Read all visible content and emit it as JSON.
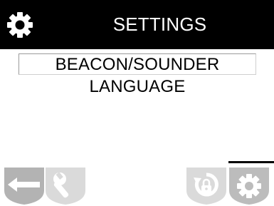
{
  "header": {
    "title": "SETTINGS",
    "icon": "gear-icon"
  },
  "menu": {
    "items": [
      {
        "label": "BEACON/SOUNDER",
        "selected": true
      },
      {
        "label": "LANGUAGE",
        "selected": false
      }
    ]
  },
  "footer": {
    "tabs": [
      {
        "icon": "back-arrow-icon",
        "active": false
      },
      {
        "icon": "wrench-icon",
        "active": false
      },
      {
        "icon": "lock-reset-icon",
        "active": false
      },
      {
        "icon": "gear-icon",
        "active": true
      }
    ]
  },
  "colors": {
    "header_bg": "#000000",
    "header_text": "#ffffff",
    "tab_dark": "#b5b5b5",
    "tab_light": "#dcdcdc",
    "tab_selected": "#bdbdbd"
  }
}
